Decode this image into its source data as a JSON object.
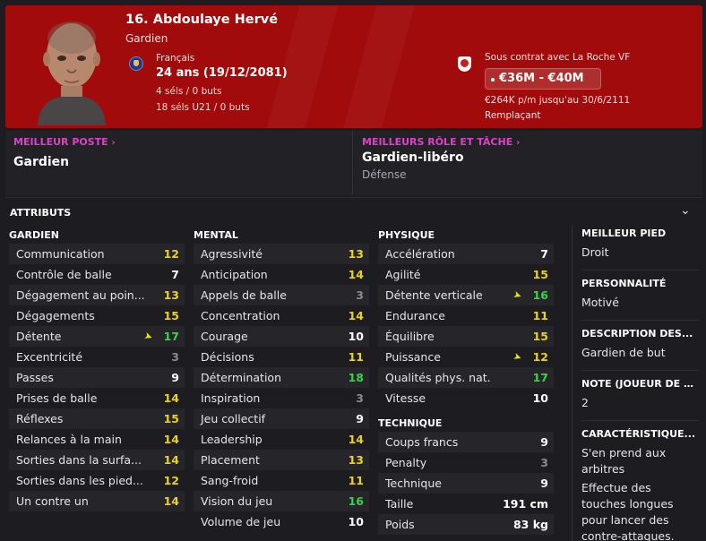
{
  "header": {
    "player_name": "16. Abdoulaye Hervé",
    "position": "Gardien",
    "nationality": "Français",
    "age": "24 ans (19/12/2081)",
    "caps": "4 séls / 0 buts",
    "caps_u21": "18 séls U21 / 0 buts",
    "contract": "Sous contrat avec La Roche VF",
    "value": "€36M - €40M",
    "wage": "€264K p/m jusqu'au 30/6/2111",
    "squad_status": "Remplaçant",
    "header_color": "#a10b0b",
    "flag_icon": "france-flag-icon",
    "club_icon": "club-badge-icon"
  },
  "roles": {
    "best_position_heading": "MEILLEUR POSTE",
    "best_position": "Gardien",
    "best_role_heading": "MEILLEURS RÔLE ET TÂCHE",
    "best_role": "Gardien-libéro",
    "best_role_duty": "Défense",
    "heading_color": "#e040c8"
  },
  "attributes": {
    "title": "ATTRIBUTS",
    "goalkeeping": {
      "heading": "GARDIEN",
      "items": [
        {
          "label": "Communication",
          "value": "12"
        },
        {
          "label": "Contrôle de balle",
          "value": "7"
        },
        {
          "label": "Dégagement au poin...",
          "value": "13"
        },
        {
          "label": "Dégagements",
          "value": "15"
        },
        {
          "label": "Détente",
          "value": "17"
        },
        {
          "label": "Excentricité",
          "value": "3"
        },
        {
          "label": "Passes",
          "value": "9"
        },
        {
          "label": "Prises de balle",
          "value": "14"
        },
        {
          "label": "Réflexes",
          "value": "15"
        },
        {
          "label": "Relances à la main",
          "value": "14"
        },
        {
          "label": "Sorties dans la surfa...",
          "value": "14"
        },
        {
          "label": "Sorties dans les pied...",
          "value": "12"
        },
        {
          "label": "Un contre un",
          "value": "14"
        }
      ]
    },
    "mental": {
      "heading": "MENTAL",
      "items": [
        {
          "label": "Agressivité",
          "value": "13"
        },
        {
          "label": "Anticipation",
          "value": "14"
        },
        {
          "label": "Appels de balle",
          "value": "3"
        },
        {
          "label": "Concentration",
          "value": "14"
        },
        {
          "label": "Courage",
          "value": "10"
        },
        {
          "label": "Décisions",
          "value": "11"
        },
        {
          "label": "Détermination",
          "value": "18"
        },
        {
          "label": "Inspiration",
          "value": "3"
        },
        {
          "label": "Jeu collectif",
          "value": "9"
        },
        {
          "label": "Leadership",
          "value": "14"
        },
        {
          "label": "Placement",
          "value": "13"
        },
        {
          "label": "Sang-froid",
          "value": "11"
        },
        {
          "label": "Vision du jeu",
          "value": "16"
        },
        {
          "label": "Volume de jeu",
          "value": "10"
        }
      ]
    },
    "physical": {
      "heading": "PHYSIQUE",
      "items": [
        {
          "label": "Accélération",
          "value": "7"
        },
        {
          "label": "Agilité",
          "value": "15"
        },
        {
          "label": "Détente verticale",
          "value": "16"
        },
        {
          "label": "Endurance",
          "value": "11"
        },
        {
          "label": "Équilibre",
          "value": "15"
        },
        {
          "label": "Puissance",
          "value": "12"
        },
        {
          "label": "Qualités phys. nat.",
          "value": "17"
        },
        {
          "label": "Vitesse",
          "value": "10"
        }
      ]
    },
    "technical": {
      "heading": "TECHNIQUE",
      "items": [
        {
          "label": "Coups francs",
          "value": "9"
        },
        {
          "label": "Penalty",
          "value": "3"
        },
        {
          "label": "Technique",
          "value": "9"
        },
        {
          "label": "Taille",
          "value": "191 cm"
        },
        {
          "label": "Poids",
          "value": "83 kg"
        }
      ]
    }
  },
  "side": {
    "foot_heading": "MEILLEUR PIED",
    "foot": "Droit",
    "personality_heading": "PERSONNALITÉ",
    "personality": "Motivé",
    "description_heading": "DESCRIPTION DES...",
    "description": "Gardien de but",
    "rating_heading": "NOTE (JOUEUR DE C...",
    "rating": "2",
    "traits_heading": "CARACTÉRISTIQUE...",
    "trait_1": "S'en prend aux arbitres",
    "trait_2": "Effectue des touches longues pour lancer des contre-attaques."
  }
}
